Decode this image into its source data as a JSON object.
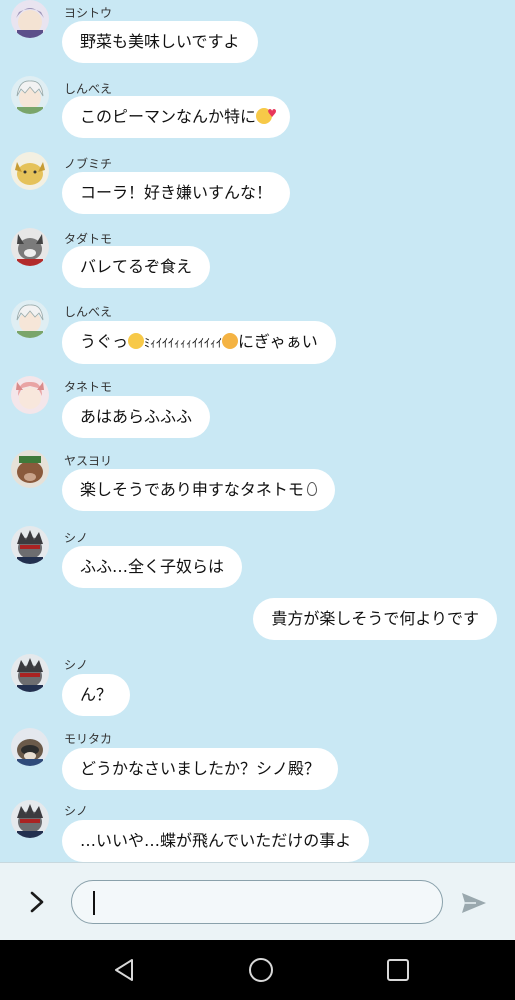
{
  "messages": [
    {
      "sender": "ヨシトウ",
      "text": "野菜も美味しいですよ",
      "avatar": "silver-hair-character"
    },
    {
      "sender": "しんべえ",
      "text": "このピーマンなんか特に",
      "emoji_after": "smiling-face-with-hearts",
      "avatar": "white-hair-character"
    },
    {
      "sender": "ノブミチ",
      "text": "コーラ！好き嫌いすんな！",
      "avatar": "yellow-dog-character"
    },
    {
      "sender": "タダトモ",
      "text": "バレてるぞ食え",
      "avatar": "dark-wolf-character"
    },
    {
      "sender": "しんべえ",
      "text_before": "うぐっ",
      "text_middle": "ﾐｨｲｲｲｨｨｨｲｲｲｨｲ",
      "text_after": "にぎゃぁい",
      "emoji_1": "smiling-face-with-tear",
      "emoji_2": "dizzy-face",
      "avatar": "white-hair-character"
    },
    {
      "sender": "タネトモ",
      "text": "あはあらふふふ",
      "avatar": "pink-hair-character"
    },
    {
      "sender": "ヤスヨリ",
      "text": "楽しそうであり申すなタネトモ",
      "emoji_after": "droplet",
      "avatar": "boar-character"
    },
    {
      "sender": "シノ",
      "text": "ふふ…全く子奴らは",
      "avatar": "grey-hair-character"
    },
    {
      "outgoing": true,
      "text": "貴方が楽しそうで何よりです"
    },
    {
      "sender": "シノ",
      "text": "ん？",
      "avatar": "grey-hair-character"
    },
    {
      "sender": "モリタカ",
      "text": "どうかなさいましたか？シノ殿？",
      "avatar": "tanuki-character"
    },
    {
      "sender": "シノ",
      "text": "…いいや…蝶が飛んでいただけの事よ",
      "avatar": "grey-hair-character"
    }
  ],
  "input": {
    "value": ""
  },
  "icons": {
    "expand": "chevron-right-icon",
    "send": "send-icon",
    "back": "back-triangle-icon",
    "home": "home-circle-icon",
    "recents": "recents-square-icon"
  },
  "colors": {
    "chat_background": "#c9e8f4",
    "bubble": "#ffffff",
    "nav_bar": "#000000"
  }
}
